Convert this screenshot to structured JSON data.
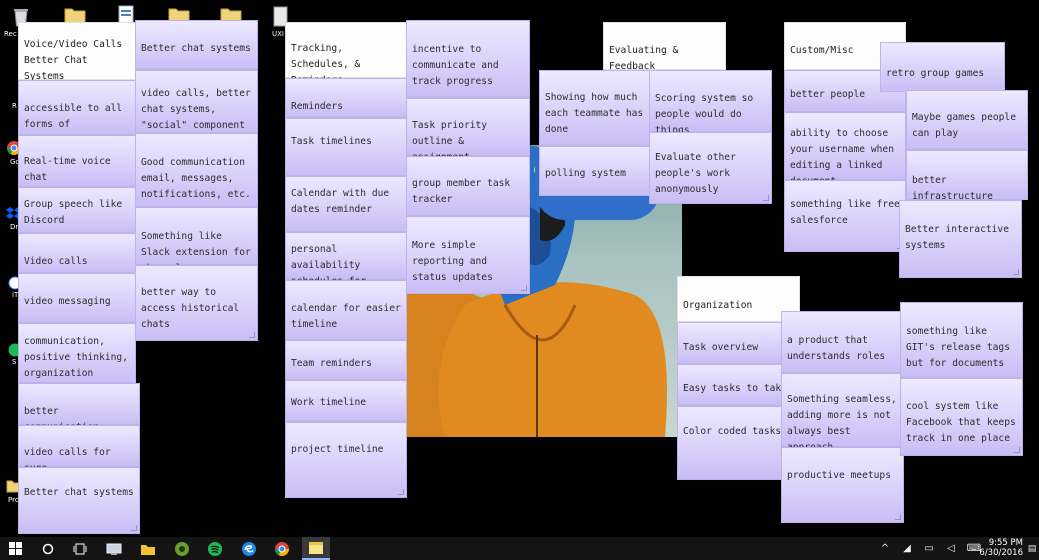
{
  "desktop_icons": [
    {
      "label": "Rec",
      "icon": "recycle-bin-icon"
    },
    {
      "label": "",
      "icon": "folder-icon"
    },
    {
      "label": "",
      "icon": "document-icon"
    },
    {
      "label": "",
      "icon": "folder-icon"
    },
    {
      "label": "",
      "icon": "folder-icon"
    },
    {
      "label": "UXI",
      "icon": "file-icon"
    },
    {
      "label": "R",
      "icon": "shortcut-icon"
    },
    {
      "label": "Go Ch",
      "icon": "chrome-icon"
    },
    {
      "label": "Dro",
      "icon": "dropbox-icon"
    },
    {
      "label": "iT",
      "icon": "itunes-icon"
    },
    {
      "label": "S",
      "icon": "spotify-icon"
    },
    {
      "label": "Pro",
      "icon": "folder-icon"
    }
  ],
  "notes": [
    {
      "text": "Voice/Video Calls\nBetter Chat Systems",
      "header": true
    },
    {
      "text": "accessible to all forms of communication"
    },
    {
      "text": "Real-time voice chat"
    },
    {
      "text": "Group speech like Discord"
    },
    {
      "text": "Video calls"
    },
    {
      "text": "video messaging"
    },
    {
      "text": "communication, positive thinking, organization"
    },
    {
      "text": "better communication"
    },
    {
      "text": "video calls for sure"
    },
    {
      "text": "Better chat systems"
    },
    {
      "text": "Better chat systems"
    },
    {
      "text": "video calls, better chat systems, \"social\" component"
    },
    {
      "text": "Good communication email, messages, notifications, etc."
    },
    {
      "text": "Something like Slack extension for channel"
    },
    {
      "text": "better way to access historical chats"
    },
    {
      "text": "Tracking, Schedules, & Reminders",
      "header": true
    },
    {
      "text": "Reminders"
    },
    {
      "text": "Task timelines"
    },
    {
      "text": "Calendar with due dates reminder"
    },
    {
      "text": "personal availability schedules for meetings"
    },
    {
      "text": "calendar for easier timeline"
    },
    {
      "text": "Team reminders"
    },
    {
      "text": "Work timeline"
    },
    {
      "text": "project timeline"
    },
    {
      "text": "incentive to communicate and track progress"
    },
    {
      "text": "Task priority outline & assignment"
    },
    {
      "text": "group member task tracker"
    },
    {
      "text": "More simple reporting and status updates"
    },
    {
      "text": "Evaluating & Feedback",
      "header": true
    },
    {
      "text": "Showing how much each teammate has done"
    },
    {
      "text": "polling system"
    },
    {
      "text": "Scoring system so people would do things"
    },
    {
      "text": "Evaluate other people's work anonymously"
    },
    {
      "text": "Custom/Misc",
      "header": true
    },
    {
      "text": "better people"
    },
    {
      "text": "ability to choose your username when editing a linked document"
    },
    {
      "text": "something like free salesforce"
    },
    {
      "text": "retro group games"
    },
    {
      "text": "Maybe games people can play"
    },
    {
      "text": "better infrastructure"
    },
    {
      "text": "Better interactive systems"
    },
    {
      "text": "Organization",
      "header": true
    },
    {
      "text": "Task overview"
    },
    {
      "text": "Easy tasks to take"
    },
    {
      "text": "Color coded tasks"
    },
    {
      "text": "a product that understands roles"
    },
    {
      "text": "Something seamless, adding more is not always best approach"
    },
    {
      "text": "productive meetups"
    },
    {
      "text": "something like GIT's release tags but for documents"
    },
    {
      "text": "cool system like Facebook that keeps track in one place"
    }
  ],
  "taskbar": {
    "items": [
      {
        "icon": "windows-start-icon"
      },
      {
        "icon": "search-circle-icon"
      },
      {
        "icon": "task-view-icon"
      },
      {
        "icon": "computer-icon"
      },
      {
        "icon": "file-explorer-icon"
      },
      {
        "icon": "media-player-icon"
      },
      {
        "icon": "spotify-icon"
      },
      {
        "icon": "edge-icon"
      },
      {
        "icon": "chrome-icon"
      },
      {
        "icon": "sticky-notes-icon"
      }
    ],
    "tray": [
      {
        "icon": "chevron-up-icon",
        "glyph": "^"
      },
      {
        "icon": "wifi-icon",
        "glyph": "◢"
      },
      {
        "icon": "battery-icon",
        "glyph": "▭"
      },
      {
        "icon": "volume-icon",
        "glyph": "◁"
      },
      {
        "icon": "keyboard-icon",
        "glyph": "⌨"
      },
      {
        "icon": "notification-icon",
        "glyph": "▤"
      }
    ],
    "time": "9:55 PM",
    "date": "6/30/2016"
  }
}
